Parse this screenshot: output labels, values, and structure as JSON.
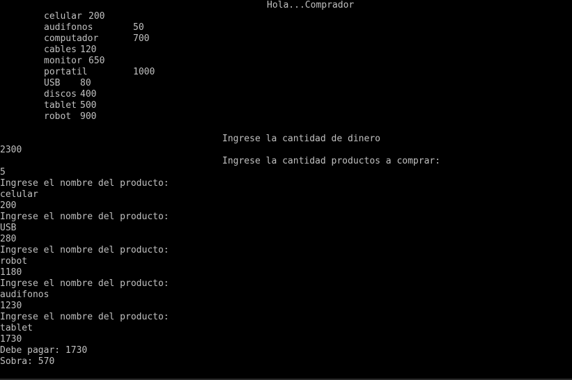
{
  "console": {
    "title": "Hola...Comprador",
    "menu": [
      {
        "name": "celular",
        "price": "200"
      },
      {
        "name": "audifonos",
        "price": "50"
      },
      {
        "name": "computador",
        "price": "700"
      },
      {
        "name": "cables",
        "price": "120"
      },
      {
        "name": "monitor",
        "price": "650"
      },
      {
        "name": "portatil",
        "price": "1000"
      },
      {
        "name": "USB",
        "price": "80"
      },
      {
        "name": "discos",
        "price": "400"
      },
      {
        "name": "tablet",
        "price": "500"
      },
      {
        "name": "robot",
        "price": "900"
      }
    ],
    "prompt_money": "Ingrese la cantidad de dinero",
    "input_money": "2300",
    "prompt_count": "Ingrese la cantidad productos a comprar:",
    "input_count": "5",
    "purchases": [
      {
        "prompt": "Ingrese el nombre del producto:",
        "product": "celular",
        "running_total": "200"
      },
      {
        "prompt": "Ingrese el nombre del producto:",
        "product": "USB",
        "running_total": "280"
      },
      {
        "prompt": "Ingrese el nombre del producto:",
        "product": "robot",
        "running_total": "1180"
      },
      {
        "prompt": "Ingrese el nombre del producto:",
        "product": "audifonos",
        "running_total": "1230"
      },
      {
        "prompt": "Ingrese el nombre del producto:",
        "product": "tablet",
        "running_total": "1730"
      }
    ],
    "summary_pay": "Debe pagar: 1730",
    "summary_change": "Sobra: 570"
  }
}
